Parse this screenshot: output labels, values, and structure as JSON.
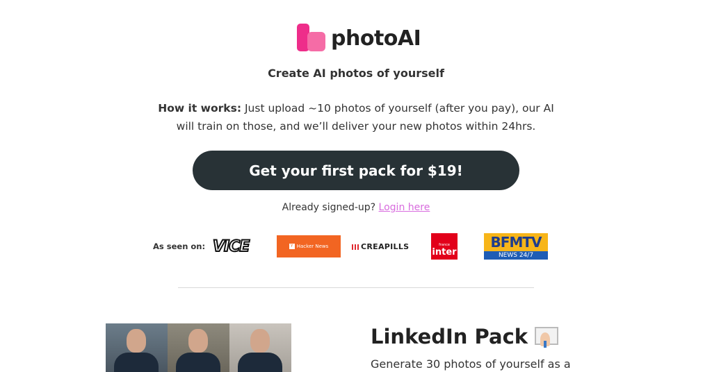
{
  "brand": {
    "name": "photoAI"
  },
  "subtitle": "Create AI photos of yourself",
  "how_it_works": {
    "label": "How it works:",
    "text": "Just upload ~10 photos of yourself (after you pay), our AI will train on those, and we’ll deliver your new photos within 24hrs."
  },
  "cta": {
    "label": "Get your first pack for $19!"
  },
  "signin": {
    "prompt": "Already signed-up?",
    "link": "Login here"
  },
  "as_seen_on": {
    "label": "As seen on:",
    "logos": {
      "vice": "VICE",
      "hacker_news": "Hacker News",
      "creapills": "CREAPILLS",
      "inter_small": "france",
      "inter": "inter",
      "bfm_top": "BFMTV",
      "bfm_bottom": "NEWS 24/7"
    }
  },
  "pack": {
    "title": "LinkedIn Pack",
    "icon": "businessman-icon",
    "description": "Generate 30 photos of yourself as a"
  },
  "colors": {
    "cta_bg": "#283236",
    "link": "#d86cde",
    "brand_pink": "#ee2d8a",
    "hn_orange": "#f26522"
  }
}
